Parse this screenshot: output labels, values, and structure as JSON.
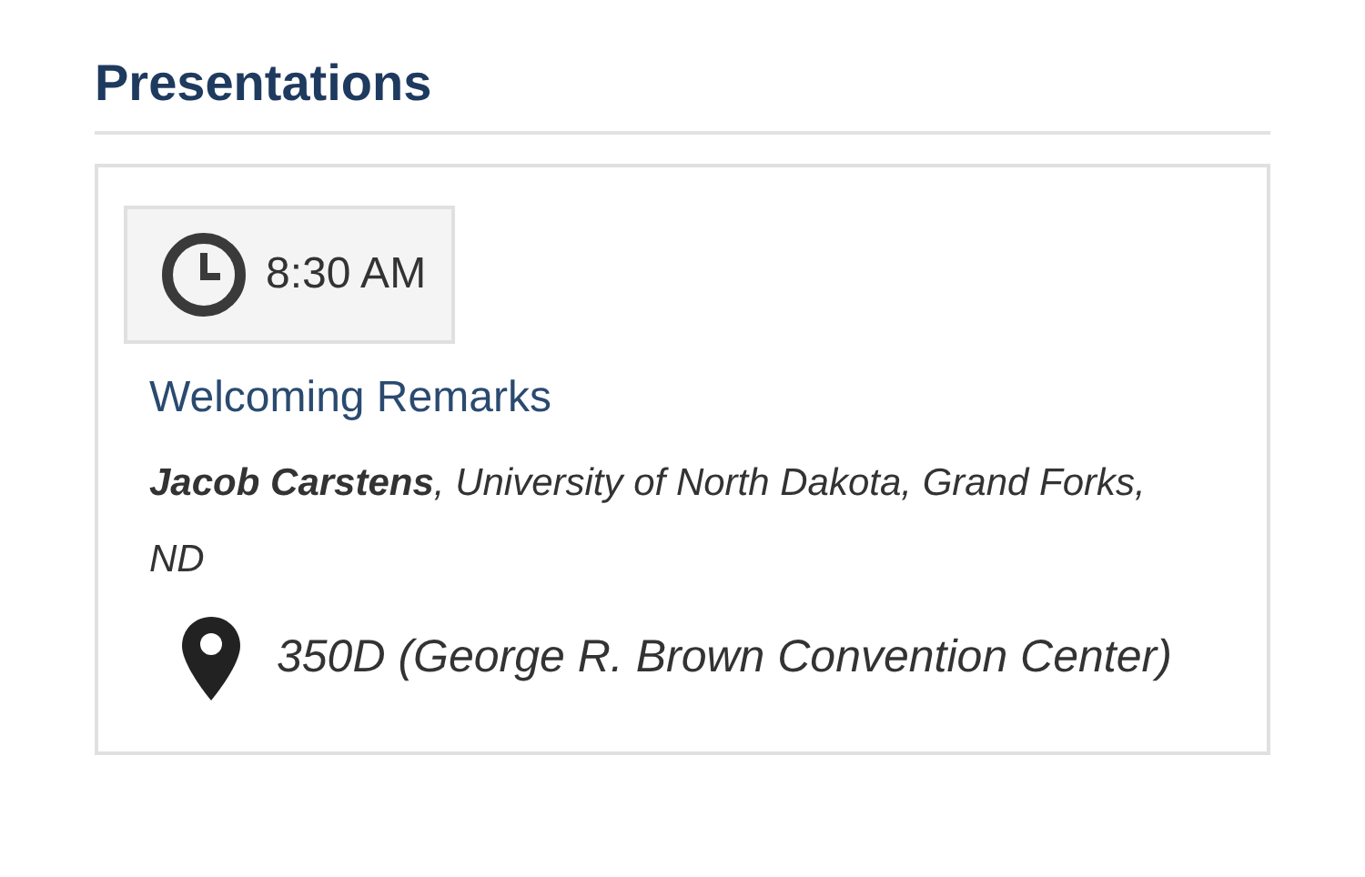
{
  "section": {
    "title": "Presentations"
  },
  "presentations": [
    {
      "time": "8:30 AM",
      "title": "Welcoming Remarks",
      "speaker": "**Jacob Carstens**, University of North Dakota, Grand Forks, ND",
      "location": "350D (George R. Brown Convention Center)"
    }
  ]
}
